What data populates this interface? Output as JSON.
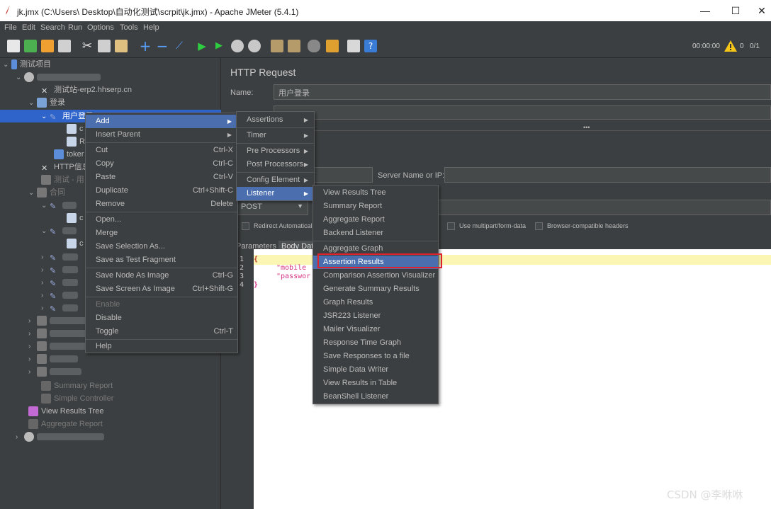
{
  "window": {
    "title": "jk.jmx (C:\\Users\\       Desktop\\自动化测试\\scrpit\\jk.jmx) - Apache JMeter (5.4.1)",
    "minimize": "—",
    "maximize": "☐",
    "close": "✕"
  },
  "menubar": [
    "File",
    "Edit",
    "Search",
    "Run",
    "Options",
    "Tools",
    "Help"
  ],
  "toolbar": {
    "timer": "00:00:00",
    "warnings": "0",
    "threads": "0/1"
  },
  "tree": {
    "root": "测试项目",
    "site": "测试站-erp2.hhserp.cn",
    "login": "登录",
    "user_login": "用户登录",
    "c1": "c",
    "r1": "R",
    "token": "toker",
    "http_info": "HTTP信息",
    "test_dim": "测试 - 用",
    "contract": "合同",
    "c2": "c",
    "c3": "c",
    "summary_report": "Summary Report",
    "simple_controller": "Simple Controller",
    "view_results_tree": "View Results Tree",
    "aggregate_report": "Aggregate Report"
  },
  "right": {
    "heading": "HTTP Request",
    "name_label": "Name:",
    "name_value": "用户登录",
    "server_label": "Server Name or IP:",
    "method": "POST",
    "redirect": "Redirect Automaticall",
    "multipart": "Use multipart/form-data",
    "browser_headers": "Browser-compatible headers",
    "tab_params": "Parameters",
    "tab_body": "Body Data",
    "dots": "•••",
    "code_lines": [
      "1",
      "2",
      "3",
      "4"
    ],
    "code_brace": "{",
    "code_mobile": "\"mobile",
    "code_password": "\"passwor"
  },
  "context_menu": {
    "items": [
      {
        "label": "Add",
        "shortcut": "",
        "submenu": true
      },
      {
        "label": "Insert Parent",
        "shortcut": "",
        "submenu": true
      },
      {
        "label": "Cut",
        "shortcut": "Ctrl-X"
      },
      {
        "label": "Copy",
        "shortcut": "Ctrl-C"
      },
      {
        "label": "Paste",
        "shortcut": "Ctrl-V"
      },
      {
        "label": "Duplicate",
        "shortcut": "Ctrl+Shift-C"
      },
      {
        "label": "Remove",
        "shortcut": "Delete"
      },
      {
        "label": "Open...",
        "shortcut": ""
      },
      {
        "label": "Merge",
        "shortcut": ""
      },
      {
        "label": "Save Selection As...",
        "shortcut": ""
      },
      {
        "label": "Save as Test Fragment",
        "shortcut": ""
      },
      {
        "label": "Save Node As Image",
        "shortcut": "Ctrl-G"
      },
      {
        "label": "Save Screen As Image",
        "shortcut": "Ctrl+Shift-G"
      },
      {
        "label": "Enable",
        "shortcut": ""
      },
      {
        "label": "Disable",
        "shortcut": ""
      },
      {
        "label": "Toggle",
        "shortcut": "Ctrl-T"
      },
      {
        "label": "Help",
        "shortcut": ""
      }
    ]
  },
  "add_menu": {
    "items": [
      "Assertions",
      "Timer",
      "Pre Processors",
      "Post Processors",
      "Config Element",
      "Listener"
    ]
  },
  "listener_menu": {
    "items": [
      "View Results Tree",
      "Summary Report",
      "Aggregate Report",
      "Backend Listener",
      "Aggregate Graph",
      "Assertion Results",
      "Comparison Assertion Visualizer",
      "Generate Summary Results",
      "Graph Results",
      "JSR223 Listener",
      "Mailer Visualizer",
      "Response Time Graph",
      "Save Responses to a file",
      "Simple Data Writer",
      "View Results in Table",
      "BeanShell Listener"
    ]
  },
  "watermark": "CSDN @李咻咻",
  "colors": {
    "background": "#3c3f41",
    "selection": "#4b6eaf",
    "tree_selection": "#2f65ca",
    "highlight_box": "#e0232b",
    "editor_line": "#fbf6b4"
  }
}
